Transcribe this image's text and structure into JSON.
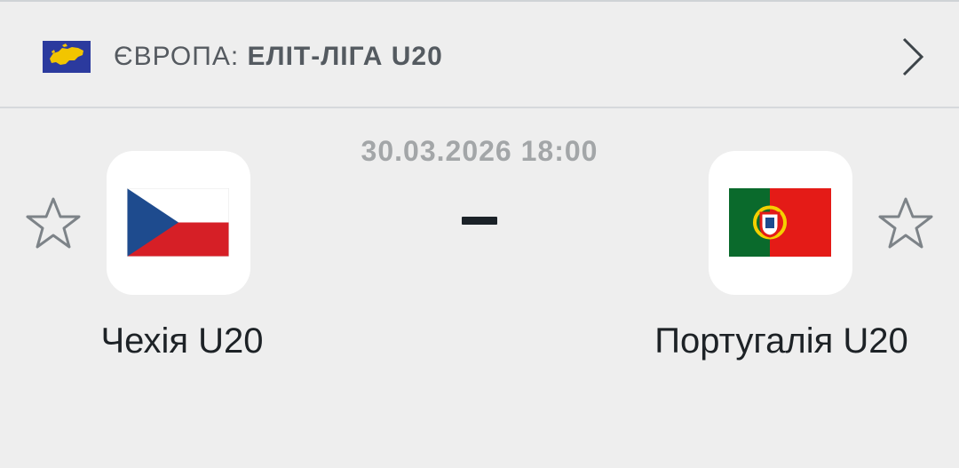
{
  "header": {
    "region": "ЄВРОПА:",
    "league": "ЕЛІТ-ЛІГА U20",
    "region_flag_icon": "europe-flag-icon",
    "chevron_icon": "chevron-right-icon"
  },
  "match": {
    "datetime": "30.03.2026 18:00",
    "score_separator": "-",
    "home": {
      "name": "Чехія U20",
      "flag_icon": "czech-flag-icon",
      "favorite_icon": "star-outline-icon"
    },
    "away": {
      "name": "Португалія U20",
      "flag_icon": "portugal-flag-icon",
      "favorite_icon": "star-outline-icon"
    }
  },
  "colors": {
    "background": "#eeeeee",
    "text_primary": "#1d2226",
    "text_muted": "#a3a6a8",
    "eu_blue": "#2b3a9e",
    "eu_yellow": "#f2c500"
  }
}
